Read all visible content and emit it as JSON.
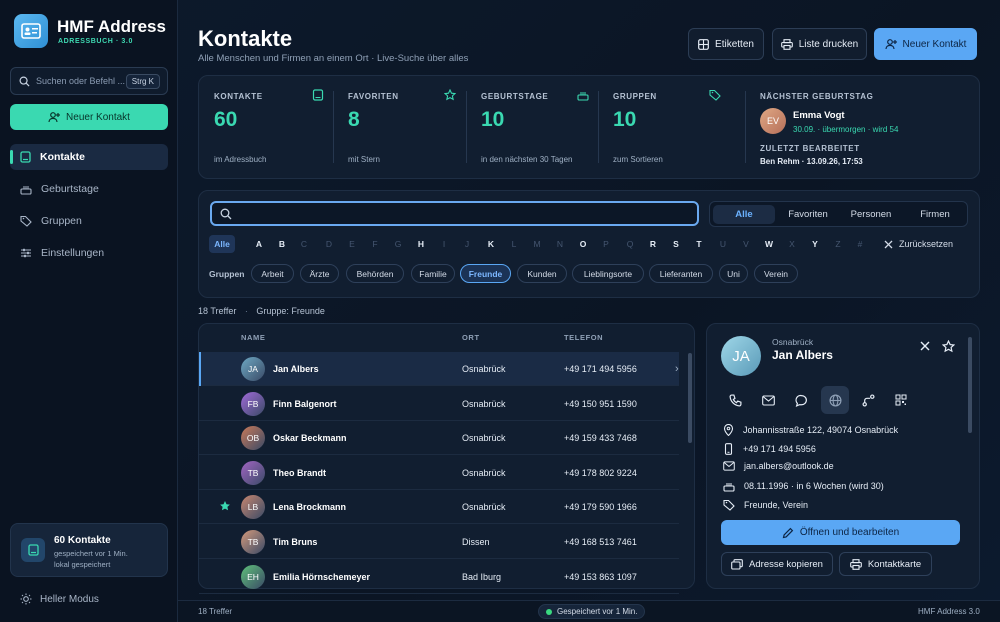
{
  "app": {
    "title": "HMF Address",
    "subtitle": "ADRESSBUCH · 3.0"
  },
  "sidebar": {
    "search_placeholder": "Suchen oder Befehl ...",
    "search_shortcut": "Strg K",
    "new_contact": "Neuer Kontakt",
    "items": [
      {
        "label": "Kontakte",
        "icon": "book-icon",
        "active": true
      },
      {
        "label": "Geburtstage",
        "icon": "cake-icon",
        "active": false
      },
      {
        "label": "Gruppen",
        "icon": "tag-icon",
        "active": false
      },
      {
        "label": "Einstellungen",
        "icon": "sliders-icon",
        "active": false
      }
    ],
    "save_card": {
      "title": "60 Kontakte",
      "line1": "gespeichert vor 1 Min.",
      "line2": "lokal gespeichert"
    },
    "theme_toggle": "Heller Modus"
  },
  "header": {
    "title": "Kontakte",
    "subtitle": "Alle Menschen und Firmen an einem Ort · Live-Suche über alles",
    "btn_labels": "Etiketten",
    "btn_print": "Liste drucken",
    "btn_new": "Neuer Kontakt"
  },
  "stats": [
    {
      "label": "KONTAKTE",
      "value": "60",
      "sub": "im Adressbuch",
      "icon": "book-icon"
    },
    {
      "label": "FAVORITEN",
      "value": "8",
      "sub": "mit Stern",
      "icon": "star-icon"
    },
    {
      "label": "GEBURTSTAGE",
      "value": "10",
      "sub": "in den nächsten 30 Tagen",
      "icon": "cake-icon"
    },
    {
      "label": "GRUPPEN",
      "value": "10",
      "sub": "zum Sortieren",
      "icon": "tag-icon"
    }
  ],
  "next_birthday": {
    "label": "NÄCHSTER GEBURTSTAG",
    "initials": "EV",
    "name": "Emma Vogt",
    "detail": "30.09. · übermorgen · wird 54",
    "edited_label": "ZULETZT BEARBEITET",
    "edited_value": "Ben Rehm · 13.09.26, 17:53"
  },
  "filter": {
    "search_value": "",
    "segments": [
      "Alle",
      "Favoriten",
      "Personen",
      "Firmen"
    ],
    "active_segment": "Alle",
    "letters": [
      "Alle",
      "A",
      "B",
      "C",
      "D",
      "E",
      "F",
      "G",
      "H",
      "I",
      "J",
      "K",
      "L",
      "M",
      "N",
      "O",
      "P",
      "Q",
      "R",
      "S",
      "T",
      "U",
      "V",
      "W",
      "X",
      "Y",
      "Z",
      "#"
    ],
    "reset": "Zurücksetzen",
    "groups_label": "Gruppen",
    "groups": [
      "Arbeit",
      "Ärzte",
      "Behörden",
      "Familie",
      "Freunde",
      "Kunden",
      "Lieblingsorte",
      "Lieferanten",
      "Uni",
      "Verein"
    ],
    "active_group": "Freunde"
  },
  "results": {
    "count": "18 Treffer",
    "sep": "·",
    "group": "Gruppe: Freunde"
  },
  "table": {
    "headers": {
      "name": "NAME",
      "city": "ORT",
      "phone": "TELEFON"
    },
    "rows": [
      {
        "initials": "JA",
        "name": "Jan Albers",
        "city": "Osnabrück",
        "phone": "+49 171 494 5956",
        "fav": false,
        "color": "#6ea9c4"
      },
      {
        "initials": "FB",
        "name": "Finn Balgenort",
        "city": "Osnabrück",
        "phone": "+49 150 951 1590",
        "fav": false,
        "color": "#a06ad8"
      },
      {
        "initials": "OB",
        "name": "Oskar Beckmann",
        "city": "Osnabrück",
        "phone": "+49 159 433 7468",
        "fav": false,
        "color": "#c97a5a"
      },
      {
        "initials": "TB",
        "name": "Theo Brandt",
        "city": "Osnabrück",
        "phone": "+49 178 802 9224",
        "fav": false,
        "color": "#a265c4"
      },
      {
        "initials": "LB",
        "name": "Lena Brockmann",
        "city": "Osnabrück",
        "phone": "+49 179 590 1966",
        "fav": true,
        "color": "#c88770"
      },
      {
        "initials": "TB",
        "name": "Tim Bruns",
        "city": "Dissen",
        "phone": "+49 168 513 7461",
        "fav": false,
        "color": "#d49a7c"
      },
      {
        "initials": "EH",
        "name": "Emilia Hörnschemeyer",
        "city": "Bad Iburg",
        "phone": "+49 153 863 1097",
        "fav": false,
        "color": "#5fc07a"
      }
    ]
  },
  "detail": {
    "initials": "JA",
    "city": "Osnabrück",
    "name": "Jan Albers",
    "address": "Johannisstraße 122, 49074 Osnabrück",
    "phone": "+49 171 494 5956",
    "email": "jan.albers@outlook.de",
    "birthday": "08.11.1996 · in 6 Wochen (wird 30)",
    "groups": "Freunde, Verein",
    "open_edit": "Öffnen und bearbeiten",
    "copy_address": "Adresse kopieren",
    "contact_card": "Kontaktkarte"
  },
  "footer": {
    "left": "18 Treffer",
    "center": "Gespeichert vor 1 Min.",
    "right": "HMF Address 3.0"
  },
  "colors": {
    "accent": "#3ad9b1",
    "primary": "#5aa7f4",
    "bg": "#0c1626"
  }
}
